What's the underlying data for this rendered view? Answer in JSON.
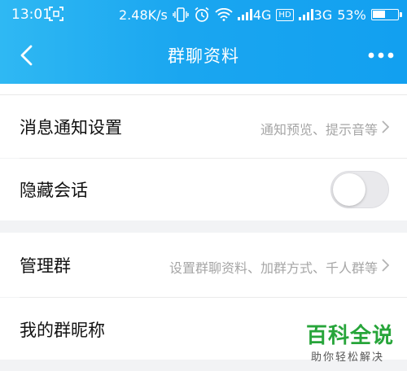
{
  "status_bar": {
    "time": "13:01",
    "speed": "2.48K/s",
    "net1": "4G",
    "hd": "HD",
    "net2": "3G",
    "battery": "53%",
    "battery_level": 0.53
  },
  "nav": {
    "title": "群聊资料"
  },
  "rows": {
    "notification": {
      "title": "消息通知设置",
      "sub": "通知预览、提示音等"
    },
    "hide_chat": {
      "title": "隐藏会话",
      "toggle_on": false
    },
    "manage_group": {
      "title": "管理群",
      "sub": "设置群聊资料、加群方式、千人群等"
    },
    "my_nickname": {
      "title": "我的群昵称"
    }
  },
  "watermark": {
    "main": "百科全说",
    "sub": "助你轻松解决"
  },
  "colors": {
    "header_start": "#2fb8f3",
    "header_end": "#12a0f0",
    "watermark_green": "#27a53a"
  }
}
